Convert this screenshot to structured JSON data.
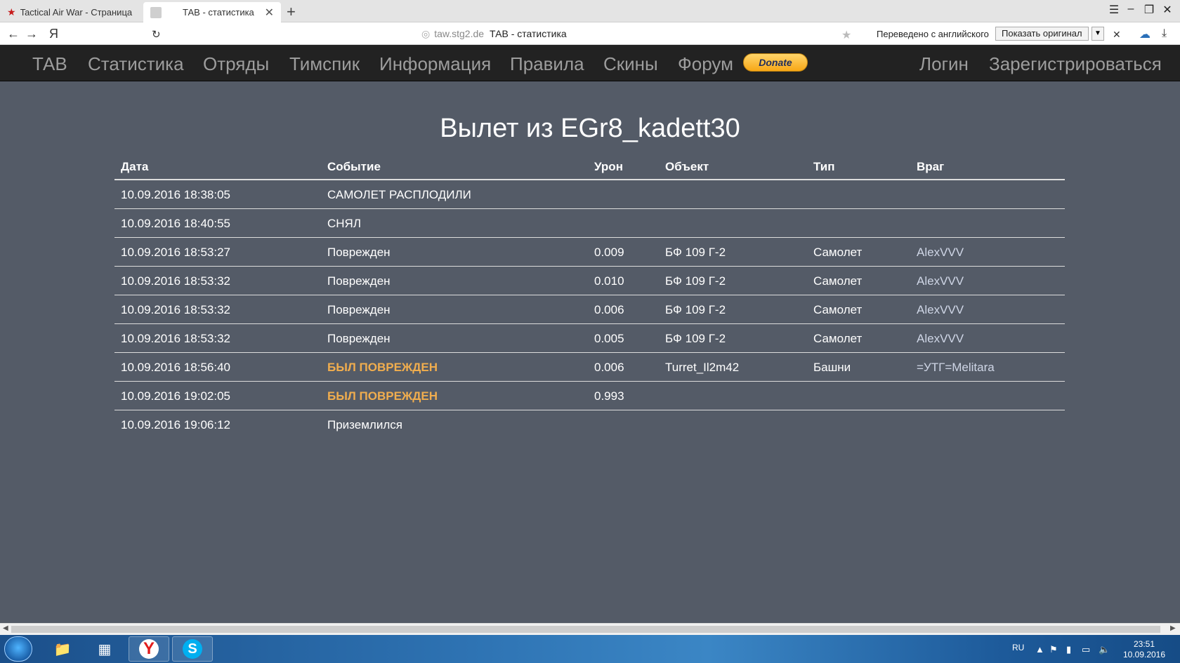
{
  "browser": {
    "tabs": [
      {
        "label": "Tactical Air War - Страница",
        "active": false
      },
      {
        "label": "ТАВ - статистика",
        "active": true
      }
    ],
    "address": {
      "domain": "taw.stg2.de",
      "title": "ТАВ - статистика"
    },
    "translate": {
      "text": "Переведено с английского",
      "button": "Показать оригинал"
    }
  },
  "nav": {
    "left": [
      "ТАВ",
      "Статистика",
      "Отряды",
      "Тимспик",
      "Информация",
      "Правила",
      "Скины",
      "Форум"
    ],
    "donate": "Donate",
    "right": [
      "Логин",
      "Зарегистрироваться"
    ]
  },
  "page": {
    "title": "Вылет из EGr8_kadett30"
  },
  "table": {
    "headers": [
      "Дата",
      "Событие",
      "Урон",
      "Объект",
      "Тип",
      "Враг"
    ],
    "rows": [
      [
        "10.09.2016 18:38:05",
        "САМОЛЕТ РАСПЛОДИЛИ",
        "",
        "",
        "",
        ""
      ],
      [
        "10.09.2016 18:40:55",
        "СНЯЛ",
        "",
        "",
        "",
        ""
      ],
      [
        "10.09.2016 18:53:27",
        "Поврежден",
        "0.009",
        "БФ 109 Г-2",
        "Самолет",
        "AlexVVV"
      ],
      [
        "10.09.2016 18:53:32",
        "Поврежден",
        "0.010",
        "БФ 109 Г-2",
        "Самолет",
        "AlexVVV"
      ],
      [
        "10.09.2016 18:53:32",
        "Поврежден",
        "0.006",
        "БФ 109 Г-2",
        "Самолет",
        "AlexVVV"
      ],
      [
        "10.09.2016 18:53:32",
        "Поврежден",
        "0.005",
        "БФ 109 Г-2",
        "Самолет",
        "AlexVVV"
      ],
      [
        "10.09.2016 18:56:40",
        "БЫЛ ПОВРЕЖДЕН",
        "0.006",
        "Turret_Il2m42",
        "Башни",
        "=УТГ=Melitara"
      ],
      [
        "10.09.2016 19:02:05",
        "БЫЛ ПОВРЕЖДЕН",
        "0.993",
        "",
        "",
        ""
      ],
      [
        "10.09.2016 19:06:12",
        "Приземлился",
        "",
        "",
        "",
        ""
      ]
    ]
  },
  "taskbar": {
    "lang": "RU",
    "time": "23:51",
    "date": "10.09.2016"
  },
  "colors": {
    "page_bg": "#545b67",
    "navbar_bg": "#222222",
    "warn": "#f0ad4e"
  }
}
